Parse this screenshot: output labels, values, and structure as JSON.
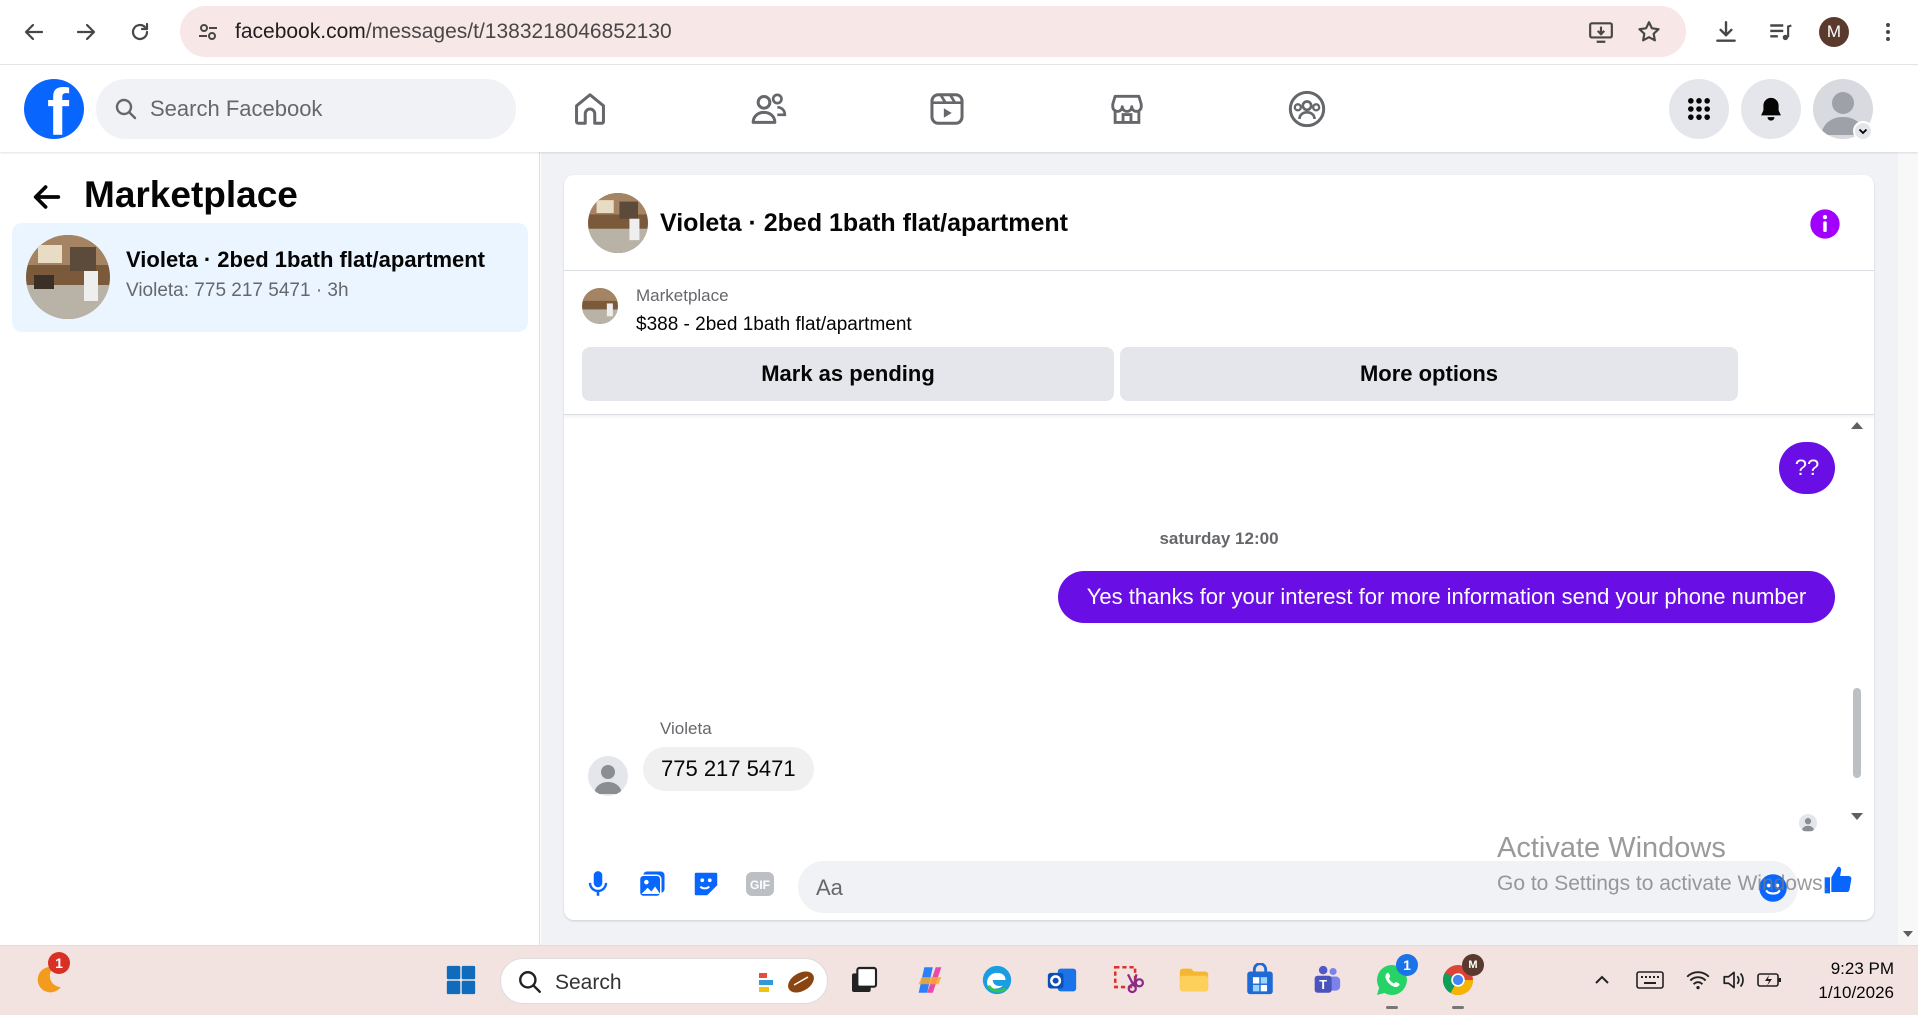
{
  "browser": {
    "url_host": "facebook.com",
    "url_path": "/messages/t/1383218046852130",
    "profile_initial": "M"
  },
  "facebook": {
    "search_placeholder": "Search Facebook"
  },
  "left_pane": {
    "title": "Marketplace",
    "conversation": {
      "title": "Violeta · 2bed 1bath flat/apartment",
      "subtitle": "Violeta: 775 217 5471 · 3h"
    }
  },
  "chat": {
    "title": "Violeta · 2bed 1bath flat/apartment",
    "listing": {
      "label": "Marketplace",
      "price_title": "$388 - 2bed 1bath flat/apartment",
      "mark_pending": "Mark as pending",
      "more_options": "More options"
    },
    "messages": {
      "out_short": "??",
      "timestamp": "saturday 12:00",
      "out_long": "Yes thanks for your interest for more information send your phone number",
      "sender": "Violeta",
      "in_text": "775 217 5471"
    },
    "composer_placeholder": "Aa"
  },
  "watermark": {
    "line1": "Activate Windows",
    "line2": "Go to Settings to activate Windows."
  },
  "taskbar": {
    "search_placeholder": "Search",
    "time": "9:23 PM",
    "date": "1/10/2026",
    "weather_badge": "1",
    "whatsapp_badge": "1",
    "chrome_badge": "M"
  },
  "colors": {
    "fb_blue": "#0866ff",
    "messenger_purple": "#6a0ee6",
    "info_purple": "#a100ff"
  }
}
